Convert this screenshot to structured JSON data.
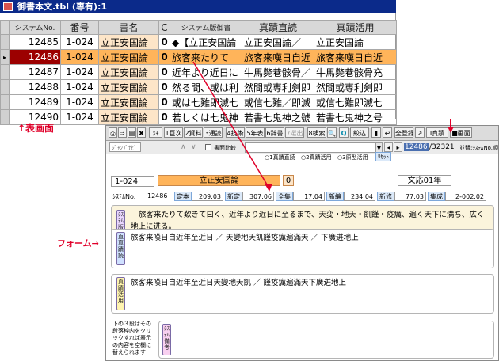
{
  "window": {
    "title": "御書本文.tbl (専有):1"
  },
  "table": {
    "columns": [
      "システムNo.",
      "番号",
      "書名",
      "C",
      "システム版御書",
      "真蹟直読",
      "真蹟活用"
    ],
    "rows": [
      [
        "12485",
        "1-024",
        "立正安国論",
        "0",
        "◆【立正安国論",
        "立正安国論／",
        "立正安国論"
      ],
      [
        "12486",
        "1-024",
        "立正安国論",
        "0",
        "旅客来たりて",
        "旅客来嘆日自近",
        "旅客来嘆日自近"
      ],
      [
        "12487",
        "1-024",
        "立正安国論",
        "0",
        "近年より近日に",
        "牛馬斃巷骸骨／",
        "牛馬斃巷骸骨充"
      ],
      [
        "12488",
        "1-024",
        "立正安国論",
        "0",
        "然る間、或は利",
        "然間或専利剣即",
        "然間或専利剣即"
      ],
      [
        "12489",
        "1-024",
        "立正安国論",
        "0",
        "或は七難即滅七",
        "或信七難／即滅",
        "或信七難即滅七"
      ],
      [
        "12490",
        "1-024",
        "立正安国論",
        "0",
        "若しくは七鬼神",
        "若書七鬼神之號",
        "若書七鬼神之号"
      ]
    ],
    "current_row_marker": "▸"
  },
  "labels": {
    "table_screen": "↑表画面",
    "form": "フォーム→"
  },
  "toolbar": {
    "buttons": [
      "⎙",
      "⇨",
      "▤",
      "✖",
      "ﾒﾓ",
      "1巨次",
      "2資料",
      "3通読",
      "4技術",
      "5年表",
      "6辞書",
      "7選出",
      "8検索",
      "🔍",
      "Q",
      "絞込",
      "▮",
      "↩",
      "全登録",
      "↗",
      "Ⅰ真蹟",
      "■画面"
    ],
    "sub_label": "ｼﾞｬﾝﾌﾟﾅﾋﾞ",
    "checkbox_label": "書面比較",
    "radio_options": [
      "1真蹟直読",
      "2真蹟活用",
      "3原型活用"
    ],
    "reset_label": "ﾘｾｯﾄ",
    "record_current": "12486",
    "record_total": "/32321",
    "sort_label": "並替:ｼｽﾃﾑNo.順"
  },
  "record": {
    "code": "1-024",
    "book_name": "立正安国論",
    "c_value": "0",
    "era": "文応01年",
    "system_no_label": "ｼｽﾃﾑNo.",
    "system_no": "12486",
    "stats": [
      {
        "label": "定本",
        "value": "209.03"
      },
      {
        "label": "新定",
        "value": "307.06"
      },
      {
        "label": "全集",
        "value": "17.04"
      },
      {
        "label": "新編",
        "value": "234.04"
      },
      {
        "label": "新修",
        "value": "77.03"
      },
      {
        "label": "集成",
        "value": "2-002.02"
      }
    ]
  },
  "panels": {
    "system_label": "ｼｽﾃﾑ版御書",
    "system_text": "旅客来たりて歎きて曰く、近年より近日に至るまで、天変・地夭・飢饉・疫癘、遍く天下に満ち、広く地上に迸る。",
    "direct_label": "直真蹟読",
    "direct_text": "旅客来嘆日自近年至近日 ／ 天變地夭飢饉疫癘遍滿天 ／ 下廣迸地上",
    "active_label": "真蹟活用",
    "active_text": "旅客来嘆日自近年至近日天變地夭飢 ／ 饉疫癘遍滿天下廣迸地上",
    "note_text": "下の３段はその段落枠内をクリックすれば表示の内容を空欄に替えられます",
    "memo_label": "ｼｽﾃﾑ備考"
  },
  "colors": {
    "title_bar": "#0b2a8a",
    "current_row": "#ffb45a",
    "book_name_bg": "#fde5c8",
    "accent_red": "#e0002a"
  }
}
